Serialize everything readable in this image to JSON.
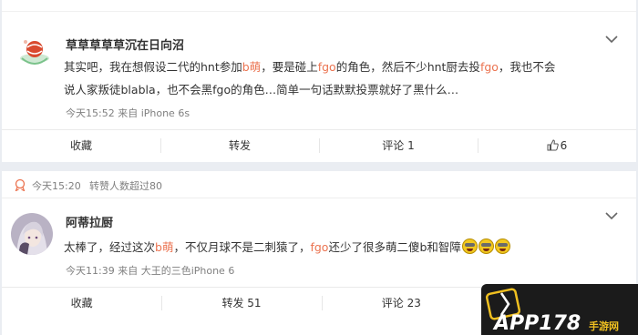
{
  "post1": {
    "username": "草草草草草沉在日向沼",
    "text_line1": [
      {
        "t": "其实吧，我在想假设二代的hnt参加",
        "red": false
      },
      {
        "t": "b萌",
        "red": true
      },
      {
        "t": "，要是碰上",
        "red": false
      },
      {
        "t": "fgo",
        "red": true
      },
      {
        "t": "的角色，然后不少hnt厨去投",
        "red": false
      },
      {
        "t": "fgo",
        "red": true
      },
      {
        "t": "，我也不会",
        "red": false
      }
    ],
    "text_line2": "说人家叛徒blabla，也不会黑fgo的角色…简单一句话默默投票就好了黑什么…",
    "meta": "今天15:52 来自 iPhone 6s",
    "actions": {
      "fav": "收藏",
      "repost": "转发",
      "comment": "评论 1",
      "like": "6"
    }
  },
  "post2": {
    "repost_time": "今天15:20",
    "repost_note": "转赞人数超过80",
    "username": "阿蒂拉厨",
    "text": [
      {
        "t": "太棒了，经过这次",
        "red": false
      },
      {
        "t": "b萌",
        "red": true
      },
      {
        "t": "，不仅月球不是二刺猿了，",
        "red": false
      },
      {
        "t": "fgo",
        "red": true
      },
      {
        "t": "还少了很多萌二傻b和智障",
        "red": false
      }
    ],
    "meta": "今天11:39 来自 大王的三色iPhone 6",
    "actions": {
      "fav": "收藏",
      "repost": "转发 51",
      "comment": "评论 23"
    }
  },
  "watermark": {
    "brand": "APP178",
    "sub": "手游网"
  },
  "colors": {
    "link_red": "#eb7350",
    "meta_gray": "#808080",
    "page_bg": "#eaedf2"
  }
}
